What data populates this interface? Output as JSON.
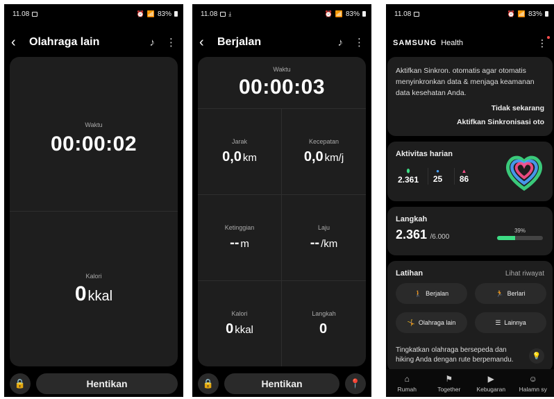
{
  "screen1": {
    "status": {
      "time": "11.08",
      "battery": "83%"
    },
    "title": "Olahraga lain",
    "time_label": "Waktu",
    "time_value": "00:00:02",
    "cal_label": "Kalori",
    "cal_value": "0",
    "cal_unit": "kkal",
    "stop_label": "Hentikan"
  },
  "screen2": {
    "status": {
      "time": "11.08",
      "battery": "83%"
    },
    "title": "Berjalan",
    "time_label": "Waktu",
    "time_value": "00:00:03",
    "stats": [
      {
        "label": "Jarak",
        "value": "0,0",
        "unit": "km"
      },
      {
        "label": "Kecepatan",
        "value": "0,0",
        "unit": "km/j"
      },
      {
        "label": "Ketinggian",
        "value": "--",
        "unit": "m"
      },
      {
        "label": "Laju",
        "value": "--",
        "unit": "/km"
      },
      {
        "label": "Kalori",
        "value": "0",
        "unit": "kkal"
      },
      {
        "label": "Langkah",
        "value": "0",
        "unit": ""
      }
    ],
    "stop_label": "Hentikan"
  },
  "screen3": {
    "status": {
      "time": "11.08",
      "battery": "83%"
    },
    "brand": "SAMSUNG",
    "brand2": "Health",
    "sync_text": "Aktifkan Sinkron. otomatis agar otomatis menyinkronkan data & menjaga keamanan data kesehatan Anda.",
    "not_now": "Tidak sekarang",
    "enable_sync": "Aktifkan Sinkronisasi oto",
    "activity_title": "Aktivitas harian",
    "activity": [
      {
        "value": "2.361",
        "color": "#3ddc84"
      },
      {
        "value": "25",
        "color": "#4aa3ff"
      },
      {
        "value": "86",
        "color": "#ff4f8b"
      }
    ],
    "steps_title": "Langkah",
    "steps_value": "2.361",
    "steps_goal": "/6.000",
    "steps_percent": "39%",
    "steps_progress": 0.39,
    "workout_title": "Latihan",
    "history_link": "Lihat riwayat",
    "workouts": [
      "Berjalan",
      "Berlari",
      "Olahraga lain",
      "Lainnya"
    ],
    "tip_text": "Tingkatkan olahraga bersepeda dan hiking Anda dengan rute berpemandu.",
    "nav": [
      "Rumah",
      "Together",
      "Kebugaran",
      "Halamn sy"
    ]
  }
}
